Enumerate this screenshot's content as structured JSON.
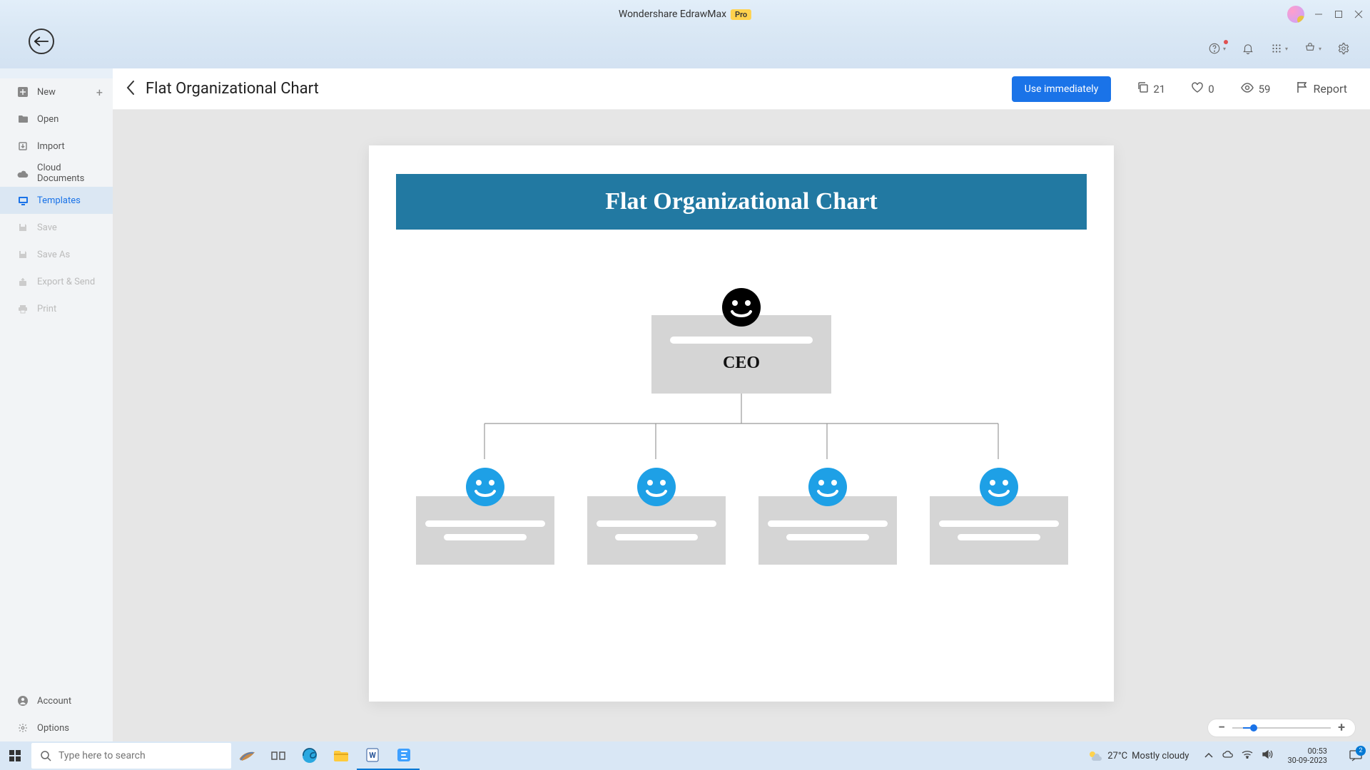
{
  "app": {
    "title": "Wondershare EdrawMax",
    "badge": "Pro"
  },
  "iconrow": {
    "help": "help",
    "bell": "bell",
    "grid": "grid",
    "cart": "cart",
    "gear": "gear"
  },
  "sidebar": {
    "items": [
      {
        "label": "New",
        "icon": "plus-square",
        "hasPlus": true
      },
      {
        "label": "Open",
        "icon": "folder"
      },
      {
        "label": "Import",
        "icon": "import"
      },
      {
        "label": "Cloud Documents",
        "icon": "cloud"
      },
      {
        "label": "Templates",
        "icon": "templates"
      },
      {
        "label": "Save",
        "icon": "save"
      },
      {
        "label": "Save As",
        "icon": "save-as"
      },
      {
        "label": "Export & Send",
        "icon": "export"
      },
      {
        "label": "Print",
        "icon": "print"
      }
    ],
    "bottom": [
      {
        "label": "Account",
        "icon": "account"
      },
      {
        "label": "Options",
        "icon": "gear"
      }
    ]
  },
  "header": {
    "title": "Flat Organizational Chart",
    "primary": "Use immediately",
    "copies": "21",
    "likes": "0",
    "views": "59",
    "report": "Report"
  },
  "chart": {
    "banner": "Flat Organizational Chart",
    "ceo": "CEO"
  },
  "taskbar": {
    "search_placeholder": "Type here to search",
    "weather_temp": "27°C",
    "weather_desc": "Mostly cloudy",
    "time": "00:53",
    "date": "30-09-2023",
    "notif_count": "2"
  }
}
